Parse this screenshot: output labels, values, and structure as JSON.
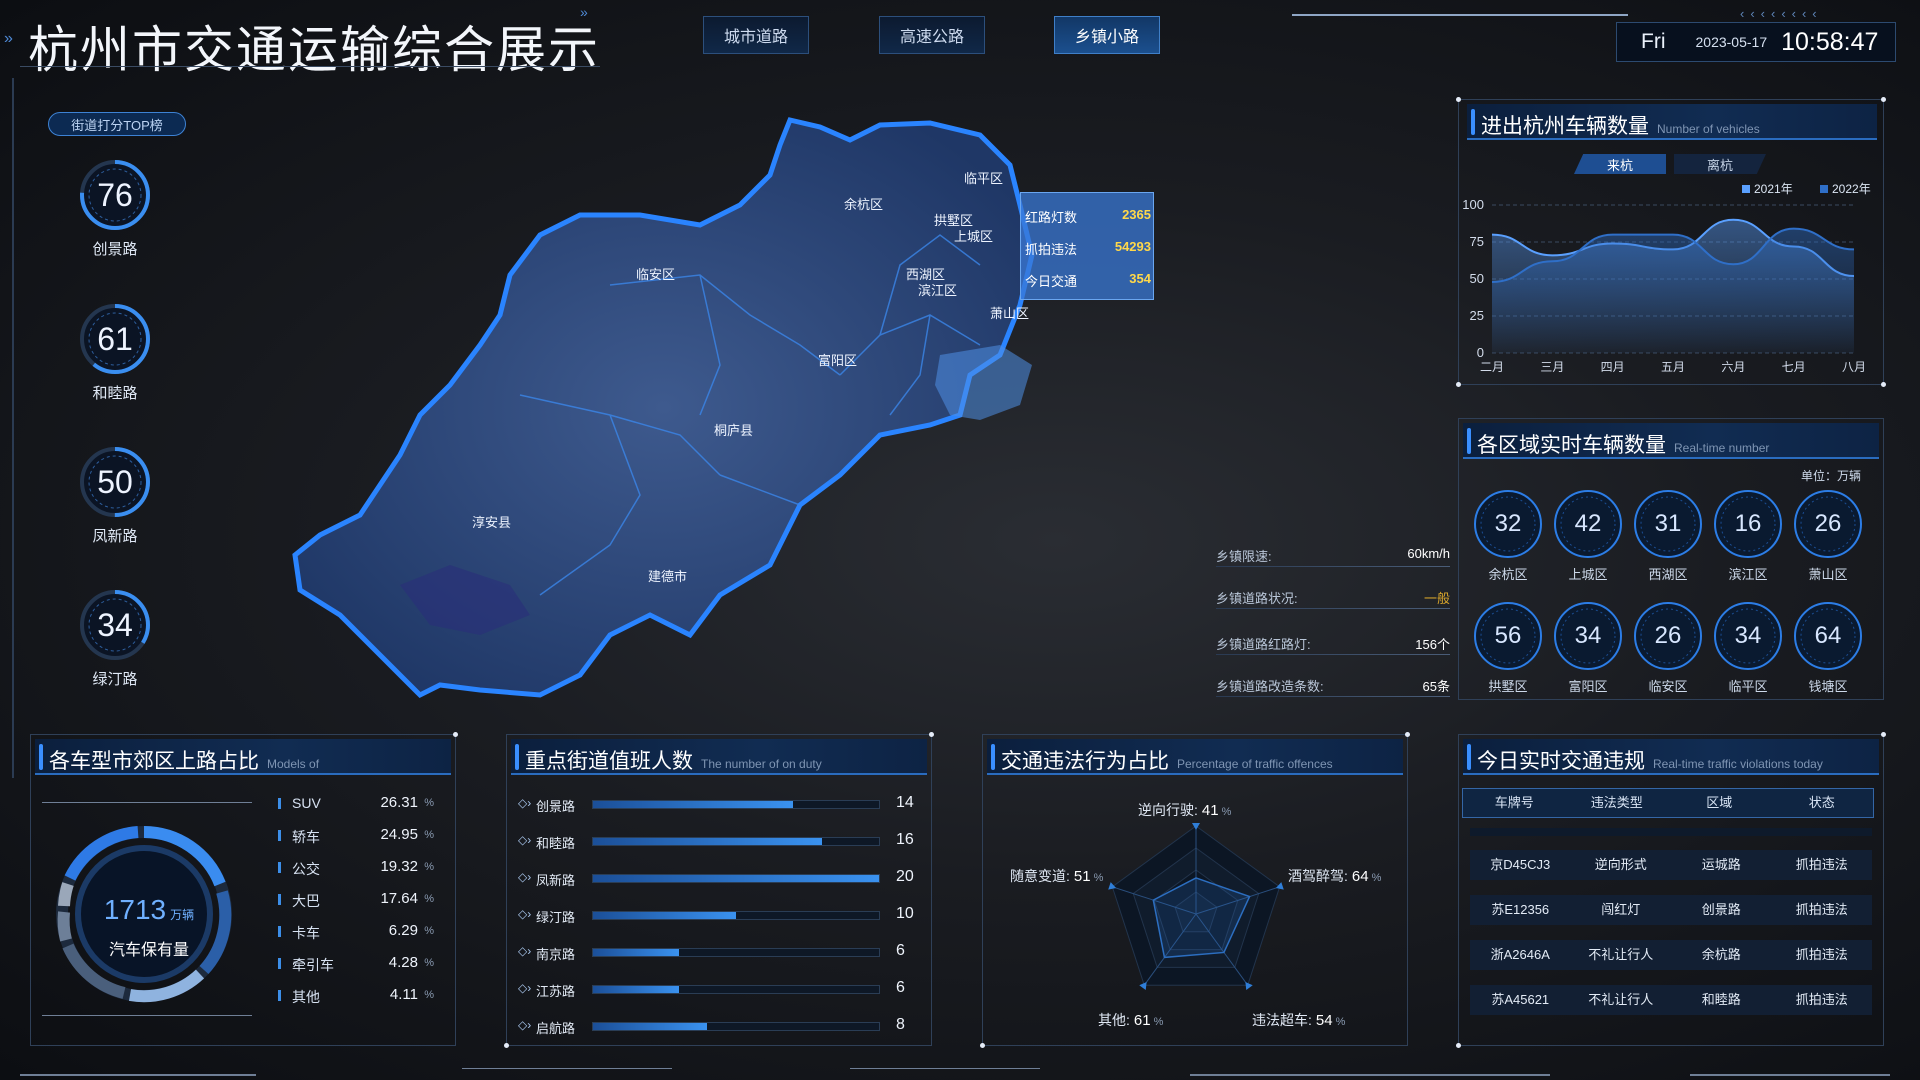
{
  "header": {
    "title": "杭州市交通运输综合展示",
    "nav": [
      "城市道路",
      "高速公路",
      "乡镇小路"
    ],
    "active_nav": "乡镇小路",
    "clock": {
      "day": "Fri",
      "date": "2023-05-17",
      "time": "10:58:47"
    }
  },
  "left": {
    "pill": "街道打分TOP榜",
    "scores": [
      {
        "value": "76",
        "label": "创景路",
        "fraction": 0.76
      },
      {
        "value": "61",
        "label": "和睦路",
        "fraction": 0.61
      },
      {
        "value": "50",
        "label": "凤新路",
        "fraction": 0.5
      },
      {
        "value": "34",
        "label": "绿汀路",
        "fraction": 0.34
      }
    ]
  },
  "map": {
    "districts": [
      "临平区",
      "余杭区",
      "拱墅区",
      "上城区",
      "临安区",
      "西湖区",
      "滨江区",
      "萧山区",
      "富阳区",
      "桐庐县",
      "淳安县",
      "建德市"
    ],
    "popup": [
      {
        "label": "红路灯数",
        "value": "2365"
      },
      {
        "label": "抓拍违法",
        "value": "54293"
      },
      {
        "label": "今日交通",
        "value": "354"
      }
    ]
  },
  "town_info": [
    {
      "label": "乡镇限速:",
      "value": "60km/h",
      "color": "#ffffff"
    },
    {
      "label": "乡镇道路状况:",
      "value": "一般",
      "color": "#d9a62b"
    },
    {
      "label": "乡镇道路红路灯:",
      "value": "156个",
      "color": "#ffffff"
    },
    {
      "label": "乡镇道路改造条数:",
      "value": "65条",
      "color": "#ffffff"
    }
  ],
  "vehicles_panel": {
    "title": "进出杭州车辆数量",
    "subtitle": "Number of vehicles",
    "tabs": [
      "来杭",
      "离杭"
    ],
    "active_tab": "来杭"
  },
  "chart_data": {
    "type": "area",
    "categories": [
      "二月",
      "三月",
      "四月",
      "五月",
      "六月",
      "七月",
      "八月"
    ],
    "ylim": [
      0,
      100
    ],
    "yticks": [
      "100",
      "75",
      "50",
      "25",
      "0"
    ],
    "grid": true,
    "legend_position": "top-right",
    "series": [
      {
        "name": "2021年",
        "values": [
          80,
          66,
          74,
          70,
          90,
          72,
          52
        ],
        "color": "#5aa0ff"
      },
      {
        "name": "2022年",
        "values": [
          48,
          62,
          80,
          80,
          60,
          84,
          70
        ],
        "color": "#2f6fc8"
      }
    ]
  },
  "region_panel": {
    "title": "各区域实时车辆数量",
    "subtitle": "Real-time number",
    "unit": "单位：万辆",
    "regions": [
      {
        "value": "32",
        "name": "余杭区"
      },
      {
        "value": "42",
        "name": "上城区"
      },
      {
        "value": "31",
        "name": "西湖区"
      },
      {
        "value": "16",
        "name": "滨江区"
      },
      {
        "value": "26",
        "name": "萧山区"
      },
      {
        "value": "56",
        "name": "拱墅区"
      },
      {
        "value": "34",
        "name": "富阳区"
      },
      {
        "value": "26",
        "name": "临安区"
      },
      {
        "value": "34",
        "name": "临平区"
      },
      {
        "value": "64",
        "name": "钱塘区"
      }
    ]
  },
  "models_panel": {
    "title": "各车型市郊区上路占比",
    "subtitle": "Models of",
    "total": "1713",
    "total_unit": "万辆",
    "total_label": "汽车保有量",
    "unit": "%",
    "items": [
      {
        "name": "SUV",
        "value": "26.31"
      },
      {
        "name": "轿车",
        "value": "24.95"
      },
      {
        "name": "公交",
        "value": "19.32"
      },
      {
        "name": "大巴",
        "value": "17.64"
      },
      {
        "name": "卡车",
        "value": "6.29"
      },
      {
        "name": "牵引车",
        "value": "4.28"
      },
      {
        "name": "其他",
        "value": "4.11"
      }
    ]
  },
  "duty_panel": {
    "title": "重点街道值班人数",
    "subtitle": "The number of on duty",
    "max": 20,
    "rows": [
      {
        "name": "创景路",
        "value": "14"
      },
      {
        "name": "和睦路",
        "value": "16"
      },
      {
        "name": "凤新路",
        "value": "20"
      },
      {
        "name": "绿汀路",
        "value": "10"
      },
      {
        "name": "南京路",
        "value": "6"
      },
      {
        "name": "江苏路",
        "value": "6"
      },
      {
        "name": "启航路",
        "value": "8"
      }
    ]
  },
  "offence_panel": {
    "title": "交通违法行为占比",
    "subtitle": "Percentage of traffic offences",
    "unit": "%",
    "max": 100,
    "axes": [
      {
        "name": "逆向行驶:",
        "value": "41"
      },
      {
        "name": "酒驾醉驾:",
        "value": "64"
      },
      {
        "name": "违法超车:",
        "value": "54"
      },
      {
        "name": "其他:",
        "value": "61"
      },
      {
        "name": "随意变道:",
        "value": "51"
      }
    ]
  },
  "violations_panel": {
    "title": "今日实时交通违规",
    "subtitle": "Real-time traffic violations today",
    "columns": [
      "车牌号",
      "违法类型",
      "区域",
      "状态"
    ],
    "rows": [
      [
        "京D45CJ3",
        "逆向形式",
        "运城路",
        "抓拍违法"
      ],
      [
        "苏E12356",
        "闯红灯",
        "创景路",
        "抓拍违法"
      ],
      [
        "浙A2646A",
        "不礼让行人",
        "余杭路",
        "抓拍违法"
      ],
      [
        "苏A45621",
        "不礼让行人",
        "和睦路",
        "抓拍违法"
      ]
    ]
  }
}
